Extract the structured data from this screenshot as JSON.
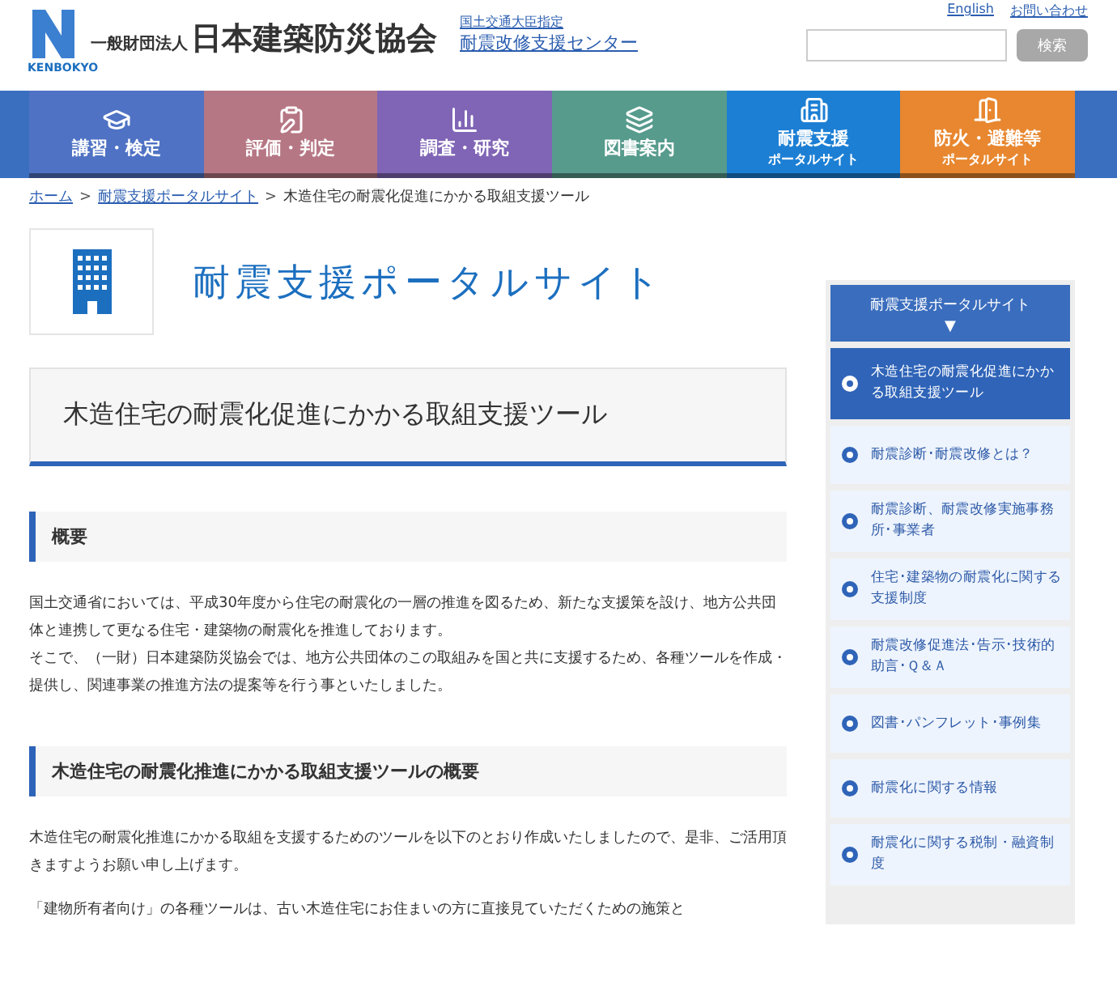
{
  "header": {
    "org_prefix": "一般財団法人",
    "org_name": "日本建築防災協会",
    "logo_text": "KENBOKYO",
    "designation": "国土交通大臣指定",
    "center_link": "耐震改修支援センター",
    "links": [
      "English",
      "お問い合わせ"
    ],
    "search_button": "検索"
  },
  "nav": [
    {
      "label": "講習・検定",
      "kind": "cap",
      "color": "#4f72c4"
    },
    {
      "label": "評価・判定",
      "kind": "clipboard",
      "color": "#b67784"
    },
    {
      "label": "調査・研究",
      "kind": "chart",
      "color": "#8065b6"
    },
    {
      "label": "図書案内",
      "kind": "books",
      "color": "#579b8d"
    },
    {
      "label": "耐震支援",
      "sub": "ポータルサイト",
      "kind": "building",
      "color": "#1c7fd4"
    },
    {
      "label": "防火・避難等",
      "sub": "ポータルサイト",
      "kind": "exit",
      "color": "#e8872f"
    }
  ],
  "breadcrumb_separator": ">",
  "breadcrumb": [
    "ホーム",
    "耐震支援ポータルサイト",
    "木造住宅の耐震化促進にかかる取組支援ツール"
  ],
  "site_title": "耐震支援ポータルサイト",
  "page_title": "木造住宅の耐震化促進にかかる取組支援ツール",
  "sections": [
    {
      "heading": "概要",
      "paragraphs": [
        "国土交通省においては、平成30年度から住宅の耐震化の一層の推進を図るため、新たな支援策を設け、地方公共団体と連携して更なる住宅・建築物の耐震化を推進しております。",
        "そこで、（一財）日本建築防災協会では、地方公共団体のこの取組みを国と共に支援するため、各種ツールを作成・提供し、関連事業の推進方法の提案等を行う事といたしました。"
      ]
    },
    {
      "heading": "木造住宅の耐震化推進にかかる取組支援ツールの概要",
      "paragraphs": [
        "木造住宅の耐震化推進にかかる取組を支援するためのツールを以下のとおり作成いたしましたので、是非、ご活用頂きますようお願い申し上げます。",
        "「建物所有者向け」の各種ツールは、古い木造住宅にお住まいの方に直接見ていただくための施策と"
      ]
    }
  ],
  "sidebar": {
    "title": "耐震支援ポータルサイト",
    "arrow": "▼",
    "items": [
      {
        "label": "木造住宅の耐震化促進にかかる取組支援ツール",
        "selected": true
      },
      {
        "label": "耐震診断･耐震改修とは？",
        "selected": false
      },
      {
        "label": "耐震診断、耐震改修実施事務所･事業者",
        "selected": false
      },
      {
        "label": "住宅･建築物の耐震化に関する支援制度",
        "selected": false
      },
      {
        "label": "耐震改修促進法･告示･技術的助言･Ｑ＆Ａ",
        "selected": false
      },
      {
        "label": "図書･パンフレット･事例集",
        "selected": false
      },
      {
        "label": "耐震化に関する情報",
        "selected": false
      },
      {
        "label": "耐震化に関する税制・融資制度",
        "selected": false
      }
    ]
  }
}
